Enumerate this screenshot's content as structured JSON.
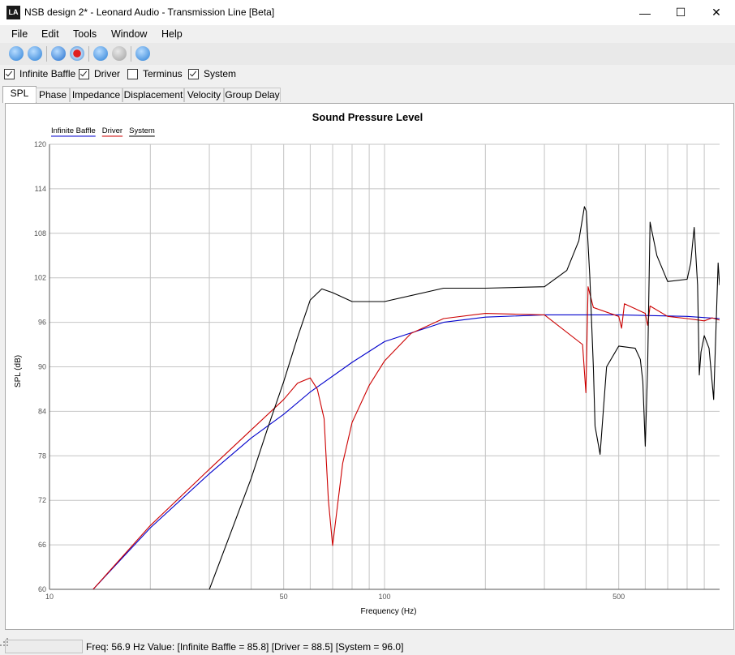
{
  "window": {
    "title": "NSB design 2* - Leonard Audio - Transmission Line [Beta]",
    "app_icon_text": "LA",
    "minimize_glyph": "—",
    "maximize_glyph": "☐",
    "close_glyph": "✕"
  },
  "menu": {
    "items": [
      "File",
      "Edit",
      "Tools",
      "Window",
      "Help"
    ]
  },
  "checkboxes": [
    {
      "label": "Infinite Baffle",
      "checked": true
    },
    {
      "label": "Driver",
      "checked": true
    },
    {
      "label": "Terminus",
      "checked": false
    },
    {
      "label": "System",
      "checked": true
    }
  ],
  "tabs": [
    {
      "label": "SPL",
      "active": true
    },
    {
      "label": "Phase",
      "active": false
    },
    {
      "label": "Impedance",
      "active": false
    },
    {
      "label": "Displacement",
      "active": false
    },
    {
      "label": "Velocity",
      "active": false
    },
    {
      "label": "Group Delay",
      "active": false
    }
  ],
  "chart_data": {
    "type": "line",
    "title": "Sound Pressure Level",
    "xlabel": "Frequency (Hz)",
    "ylabel": "SPL (dB)",
    "x_scale": "log",
    "xlim": [
      10,
      1000
    ],
    "ylim": [
      60,
      120
    ],
    "x_ticks": [
      {
        "value": 10,
        "label": "10"
      },
      {
        "value": 50,
        "label": "50"
      },
      {
        "value": 100,
        "label": "100"
      },
      {
        "value": 500,
        "label": "500"
      }
    ],
    "y_ticks": [
      60,
      66,
      72,
      78,
      84,
      90,
      96,
      102,
      108,
      114,
      120
    ],
    "grid": true,
    "legend": "top-left",
    "series": [
      {
        "name": "Infinite Baffle",
        "color": "#0000cc",
        "x": [
          13.5,
          20,
          30,
          40,
          50,
          60,
          80,
          100,
          150,
          200,
          300,
          500,
          800,
          1000
        ],
        "y": [
          60,
          68.3,
          75.6,
          80.4,
          83.6,
          86.6,
          90.6,
          93.4,
          96,
          96.7,
          97,
          97,
          96.8,
          96.5
        ]
      },
      {
        "name": "Driver",
        "color": "#cc0000",
        "x": [
          13.5,
          20,
          30,
          40,
          50,
          55,
          60,
          63,
          66,
          68,
          70,
          75,
          80,
          90,
          100,
          120,
          150,
          200,
          300,
          390,
          399,
          405,
          420,
          500,
          510,
          520,
          600,
          610,
          620,
          700,
          800,
          900,
          950,
          1000
        ],
        "y": [
          60,
          68.6,
          76.2,
          81.5,
          85.6,
          87.8,
          88.5,
          87,
          83,
          72,
          65.9,
          77,
          82.5,
          87.5,
          90.8,
          94.5,
          96.5,
          97.2,
          97,
          93,
          86.5,
          100.8,
          98,
          96.8,
          95.2,
          98.5,
          97.2,
          95.6,
          98.2,
          96.8,
          96.5,
          96.2,
          96.6,
          96.3
        ]
      },
      {
        "name": "System",
        "color": "#000000",
        "x": [
          30,
          35,
          40,
          45,
          50,
          55,
          60,
          65,
          70,
          80,
          100,
          150,
          200,
          300,
          350,
          380,
          395,
          400,
          410,
          420,
          425,
          440,
          460,
          500,
          560,
          580,
          590,
          600,
          610,
          620,
          650,
          700,
          800,
          820,
          840,
          860,
          870,
          880,
          900,
          930,
          960,
          990,
          1000
        ],
        "y": [
          60,
          68,
          75,
          82,
          88,
          94,
          99,
          100.5,
          100,
          98.8,
          98.8,
          100.6,
          100.6,
          100.8,
          103,
          107,
          111.6,
          111,
          102,
          90,
          82,
          78.2,
          90,
          92.8,
          92.5,
          91,
          88,
          79.3,
          90,
          109.5,
          105,
          101.5,
          101.8,
          104,
          108.8,
          101,
          88.9,
          92,
          94.2,
          92.5,
          85.6,
          104,
          101
        ]
      }
    ]
  },
  "status": {
    "text": "Freq: 56.9 Hz  Value: [Infinite Baffle = 85.8]  [Driver = 88.5]  [System = 96.0]"
  }
}
